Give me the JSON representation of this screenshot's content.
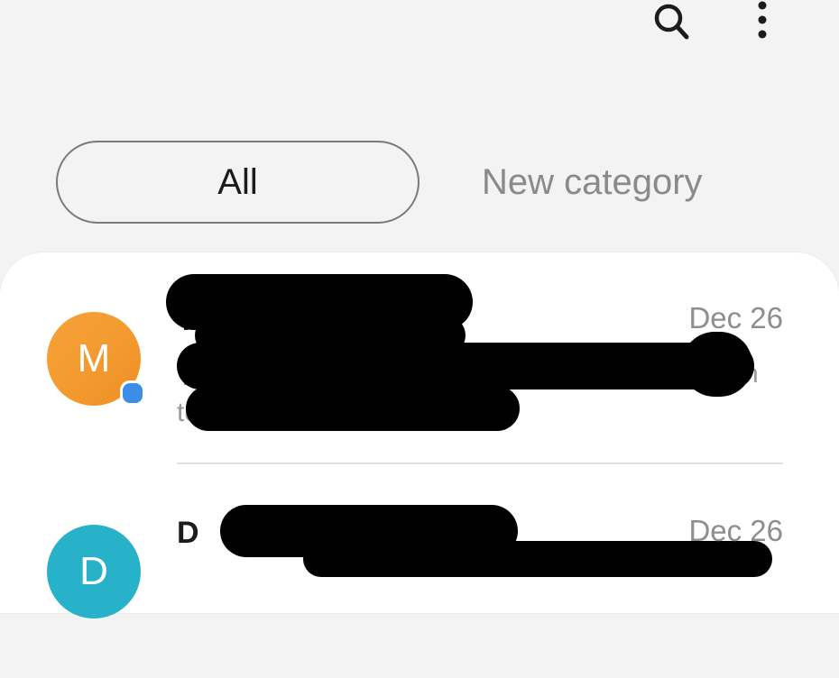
{
  "toolbar": {
    "search_icon": "search-icon",
    "more_icon": "more-vertical-icon"
  },
  "categories": [
    {
      "label": "All",
      "selected": true
    },
    {
      "label": "New category",
      "selected": false
    }
  ],
  "conversations": [
    {
      "avatar_letter": "M",
      "avatar_color": "#f39a2e",
      "name": "T",
      "preview_start": "T",
      "preview_line2": "te",
      "preview_end": "n",
      "date": "Dec 26",
      "unread": true
    },
    {
      "avatar_letter": "D",
      "avatar_color": "#27b2c9",
      "name": "D",
      "date": "Dec 26",
      "unread": false
    }
  ],
  "colors": {
    "background": "#f3f3f3",
    "card": "#ffffff",
    "unread_dot": "#3b8de5",
    "secondary_text": "#8e8e8e"
  }
}
